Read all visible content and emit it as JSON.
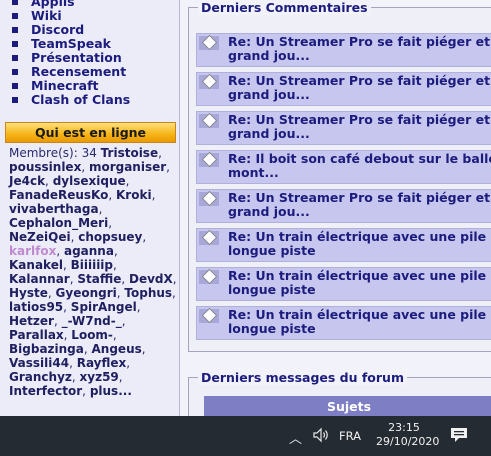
{
  "sidebar": {
    "menu": [
      "Applis",
      "Wiki",
      "Discord",
      "TeamSpeak",
      "Présentation",
      "Recensement",
      "Minecraft",
      "Clash of Clans"
    ],
    "online": {
      "title": "Qui est en ligne",
      "count_label": "Membre(s): 34",
      "members": [
        "Tristoise",
        "poussinlex",
        "morganiser",
        "Je4ck",
        "dylsexique",
        "FanadeReusKo",
        "Kroki",
        "vivaberthaga",
        "Cephalon_Meri",
        "NeZeiQei",
        "chopsuey",
        "karlfox",
        "aganna",
        "Kanakel",
        "Biiiiiip",
        "Kalannar",
        "Staffie",
        "DevdX",
        "Hyste",
        "Gyeongri",
        "Tophus",
        "latios95",
        "SpirAngel",
        "Hetzer",
        "_-W7nd-_",
        "Parallax",
        "Loom-",
        "Bigbazinga",
        "Angeus",
        "Vassili44",
        "Rayflex",
        "Granchyz",
        "xyz59",
        "Interfector"
      ],
      "highlighted": "karlfox",
      "more_label": "plus..."
    }
  },
  "main": {
    "comments_title": "Derniers Commentaires",
    "comments": [
      "Re: Un Streamer Pro se fait piéger et grand jou...",
      "Re: Un Streamer Pro se fait piéger et grand jou...",
      "Re: Un Streamer Pro se fait piéger et grand jou...",
      "Re: Il boit son café debout sur le balle mont...",
      "Re: Un Streamer Pro se fait piéger et grand jou...",
      "Re: Un train électrique avec une pile s longue piste",
      "Re: Un train électrique avec une pile s longue piste",
      "Re: Un train électrique avec une pile s longue piste"
    ],
    "forum_title": "Derniers messages du forum",
    "forum_header": "Sujets"
  },
  "taskbar": {
    "language": "FRA",
    "time": "23:15",
    "date": "29/10/2020",
    "icons": [
      "chevron-up-icon",
      "volume-icon",
      "notification-icon"
    ]
  },
  "colors": {
    "link": "#1c1c7e",
    "comment_bg": "#c6c6ee",
    "online_header": "#f6b417",
    "table_header": "#7e7ec4",
    "taskbar": "#252b33"
  }
}
